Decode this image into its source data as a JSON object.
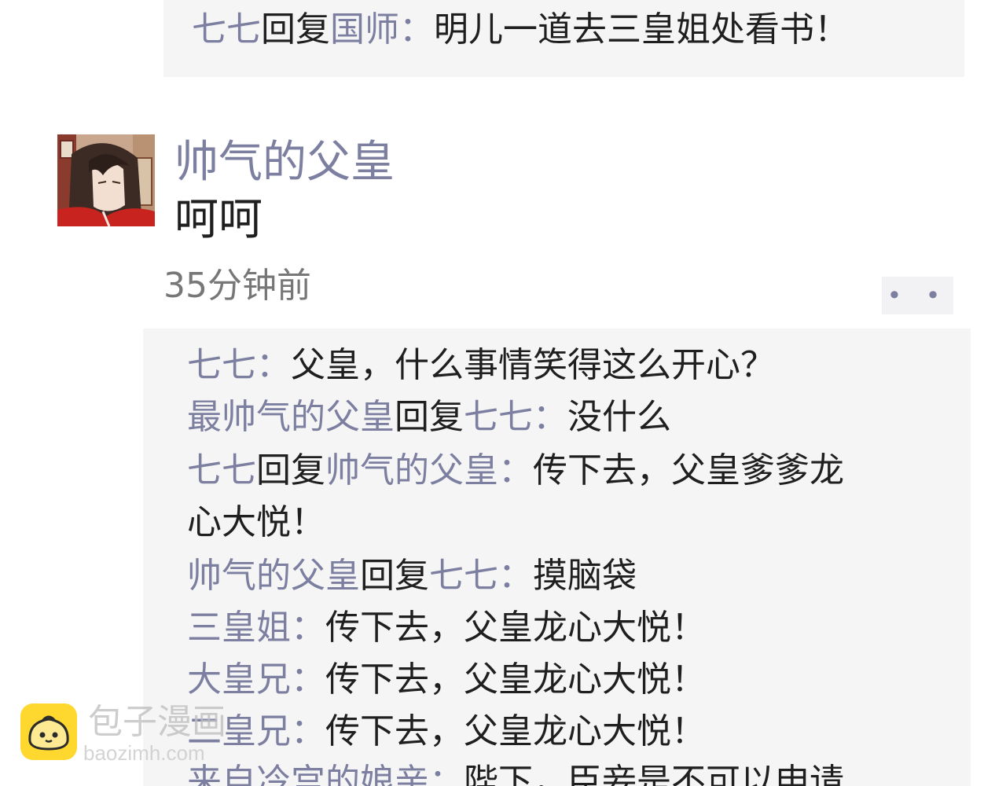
{
  "top_reply": {
    "from": "七七",
    "verb": "回复",
    "to": "国师",
    "colon": "：",
    "text": "明儿一道去三皇姐处看书！"
  },
  "post": {
    "poster_name": "帅气的父皇",
    "content": "呵呵",
    "timestamp": "35分钟前",
    "more_label": "• •"
  },
  "comments": [
    {
      "from": "七七",
      "verb": "",
      "to": "",
      "colon": "：",
      "text": "父皇，什么事情笑得这么开心？"
    },
    {
      "from": "最帅气的父皇",
      "verb": "回复",
      "to": "七七",
      "colon": "：",
      "text": "没什么"
    },
    {
      "from": "七七",
      "verb": "回复",
      "to": "帅气的父皇",
      "colon": "：",
      "text": "传下去，父皇爹爹龙"
    },
    {
      "from": "",
      "verb": "",
      "to": "",
      "colon": "",
      "text": "心大悦！"
    },
    {
      "from": "帅气的父皇",
      "verb": "回复",
      "to": "七七",
      "colon": "：",
      "text": "摸脑袋"
    },
    {
      "from": "三皇姐",
      "verb": "",
      "to": "",
      "colon": "：",
      "text": "传下去，父皇龙心大悦！"
    },
    {
      "from": "大皇兄",
      "verb": "",
      "to": "",
      "colon": "：",
      "text": "传下去，父皇龙心大悦！"
    },
    {
      "from": "二皇兄",
      "verb": "",
      "to": "",
      "colon": "：",
      "text": "传下去，父皇龙心大悦！"
    },
    {
      "from": "来自冷宫的娘亲",
      "verb": "",
      "to": "",
      "colon": "：",
      "text": "陛下，臣妾是不可以申请"
    }
  ],
  "watermark": {
    "title": "包子漫画",
    "url": "baozimh.com"
  },
  "colors": {
    "name": "#7c7fa0",
    "text": "#1f1f1f",
    "panel": "#f5f5f6",
    "logo": "#ffd51e"
  }
}
